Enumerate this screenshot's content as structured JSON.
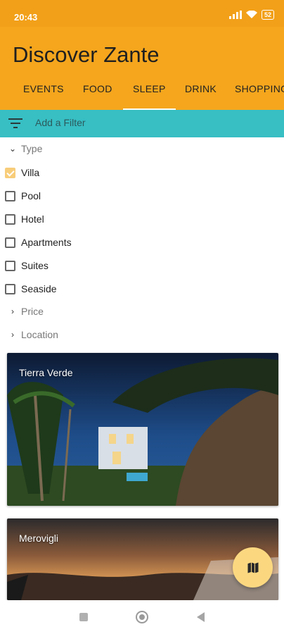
{
  "status": {
    "time": "20:43",
    "battery": "52"
  },
  "app": {
    "title": "Discover Zante"
  },
  "tabs": [
    {
      "label": "EVENTS"
    },
    {
      "label": "FOOD"
    },
    {
      "label": "SLEEP",
      "active": true
    },
    {
      "label": "DRINK"
    },
    {
      "label": "SHOPPING"
    }
  ],
  "filter": {
    "placeholder": "Add a Filter"
  },
  "sections": {
    "type": "Type",
    "price": "Price",
    "location": "Location"
  },
  "type_options": [
    {
      "label": "Villa",
      "checked": true
    },
    {
      "label": "Pool",
      "checked": false
    },
    {
      "label": "Hotel",
      "checked": false
    },
    {
      "label": "Apartments",
      "checked": false
    },
    {
      "label": "Suites",
      "checked": false
    },
    {
      "label": "Seaside",
      "checked": false
    }
  ],
  "cards": [
    {
      "name": "Tierra Verde"
    },
    {
      "name": "Merovigli"
    }
  ],
  "colors": {
    "appbar": "#f5a61d",
    "filterbar": "#37bfc4",
    "fab": "#fbd880",
    "check": "#f8cd7a"
  },
  "icons": {
    "fab": "map-icon",
    "filter": "filter-list-icon"
  }
}
